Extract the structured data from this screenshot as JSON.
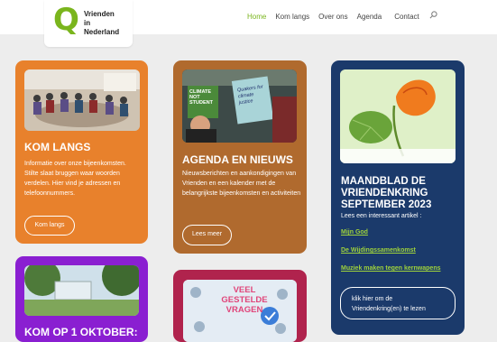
{
  "logo": {
    "letter": "Q",
    "line1": "Vrienden",
    "line2": "in",
    "line3": "Nederland"
  },
  "nav": {
    "items": [
      "Home",
      "Kom langs",
      "Over ons",
      "Agenda",
      "Contact"
    ],
    "search_icon": "search-icon"
  },
  "cards": {
    "kom_langs": {
      "title": "KOM LANGS",
      "text": "Informatie over onze bijeenkomsten. Stilte slaat bruggen waar woorden verdelen. Hier vind je adressen en telefoonnummers.",
      "button": "Kom langs"
    },
    "agenda": {
      "title": "AGENDA EN NIEUWS",
      "text": "Nieuwsberichten en aankondigingen van Vrienden en een kalender met de belangrijkste bijeenkomsten en activiteiten",
      "button": "Lees meer",
      "sign1": "CLIMATE NOT STUDENT",
      "sign2": "Quakers for climate justice"
    },
    "maandblad": {
      "title": "MAANDBLAD DE VRIENDENKRING SEPTEMBER 2023",
      "subtitle": "Lees een interessant artikel :",
      "links": [
        "Mijn God",
        "De Wijdingssamenkomst",
        "Muziek maken tegen kernwapens"
      ],
      "button": "klik hier om de Vriendenkring(en) te lezen"
    },
    "kom_op": {
      "title": "KOM OP 1 OKTOBER:"
    },
    "vragen": {
      "title": "VEEL GESTELDE VRAGEN"
    }
  },
  "colors": {
    "accent": "#7ab51d",
    "orange": "#e8812c",
    "brown": "#b06a2e",
    "navy": "#1b3a6b",
    "purple": "#8a1fd1",
    "magenta": "#b0234d"
  }
}
